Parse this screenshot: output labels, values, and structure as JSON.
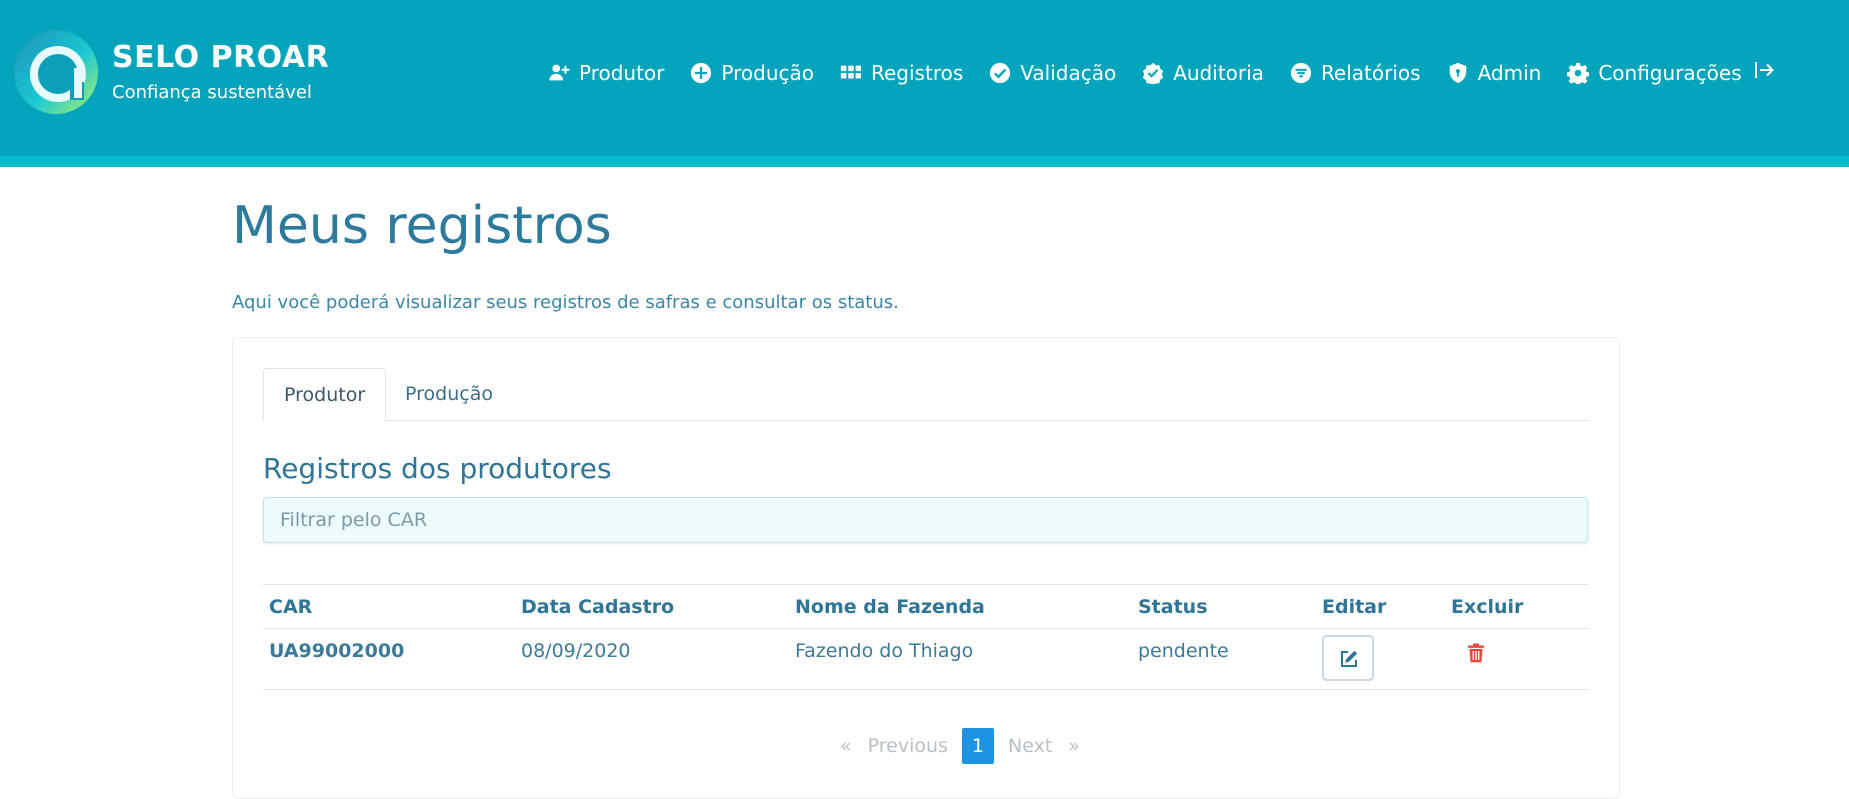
{
  "brand": {
    "title": "SELO PROAR",
    "subtitle": "Confiança sustentável"
  },
  "nav": {
    "items": [
      {
        "label": "Produtor",
        "icon": "user-plus-icon"
      },
      {
        "label": "Produção",
        "icon": "plus-circle-icon"
      },
      {
        "label": "Registros",
        "icon": "grid-icon"
      },
      {
        "label": "Validação",
        "icon": "check-circle-icon"
      },
      {
        "label": "Auditoria",
        "icon": "badge-check-icon"
      },
      {
        "label": "Relatórios",
        "icon": "filter-circle-icon"
      },
      {
        "label": "Admin",
        "icon": "shield-icon"
      },
      {
        "label": "Configurações",
        "icon": "gear-icon"
      }
    ],
    "logout_icon": "logout-icon"
  },
  "page": {
    "title": "Meus registros",
    "description": "Aqui você poderá visualizar seus registros de safras e consultar os status."
  },
  "tabs": [
    {
      "label": "Produtor",
      "active": true
    },
    {
      "label": "Produção",
      "active": false
    }
  ],
  "section": {
    "title": "Registros dos produtores",
    "filter_placeholder": "Filtrar pelo CAR",
    "filter_value": ""
  },
  "table": {
    "headers": [
      "CAR",
      "Data Cadastro",
      "Nome da Fazenda",
      "Status",
      "Editar",
      "Excluir"
    ],
    "rows": [
      {
        "car": "UA99002000",
        "date": "08/09/2020",
        "farm": "Fazendo do Thiago",
        "status": "pendente"
      }
    ]
  },
  "pagination": {
    "first": "«",
    "previous": "Previous",
    "current": "1",
    "next": "Next",
    "last": "»"
  },
  "colors": {
    "header": "#04a5bc",
    "header_stripe": "#06bccc",
    "primary_text": "#2f7596",
    "delete": "#e8483b",
    "pagination_active": "#1c93e3"
  }
}
